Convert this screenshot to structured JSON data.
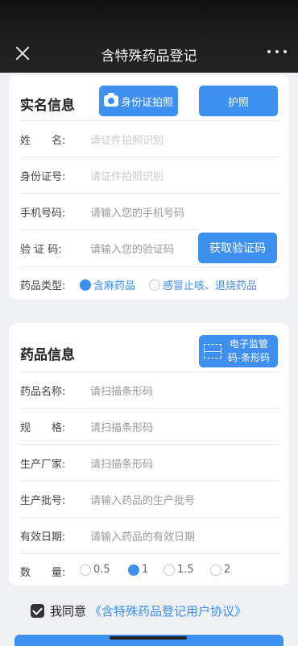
{
  "header": {
    "title": "含特殊药品登记"
  },
  "identity": {
    "title": "实名信息",
    "id_photo_button": "身份证拍照",
    "passport_button": "护照",
    "fields": [
      {
        "label": "姓　　名:",
        "placeholder": "请证件拍照识别"
      },
      {
        "label": "身份证号:",
        "placeholder": "请证件拍照识别"
      },
      {
        "label": "手机号码:",
        "placeholder": "请输入您的手机号码"
      },
      {
        "label": "验  证  码:",
        "placeholder": "请输入您的验证码"
      }
    ],
    "get_code_button": "获取验证码",
    "drug_type": {
      "label": "药品类型:",
      "options": [
        "含麻药品",
        "感冒止咳、退烧药品"
      ],
      "selected": "含麻药品"
    }
  },
  "drug": {
    "title": "药品信息",
    "scan_button": "电子监管码-条形码",
    "fields": [
      {
        "label": "药品名称:",
        "placeholder": "请扫描条形码"
      },
      {
        "label": "规　　格:",
        "placeholder": "请扫描条形码"
      },
      {
        "label": "生产厂家:",
        "placeholder": "请扫描条形码"
      },
      {
        "label": "生产批号:",
        "placeholder": "请输入药品的生产批号"
      },
      {
        "label": "有效日期:",
        "placeholder": "请输入药品的有效日期"
      }
    ],
    "quantity": {
      "label": "数　　量:",
      "options": [
        "0.5",
        "1",
        "1.5",
        "2"
      ],
      "selected": "1"
    }
  },
  "agreement": {
    "checked": true,
    "text": "我同意",
    "link": "《含特殊药品登记用户协议》"
  },
  "colors": {
    "accent": "#3d8ff0",
    "header_bg": "#1e1e1e"
  }
}
